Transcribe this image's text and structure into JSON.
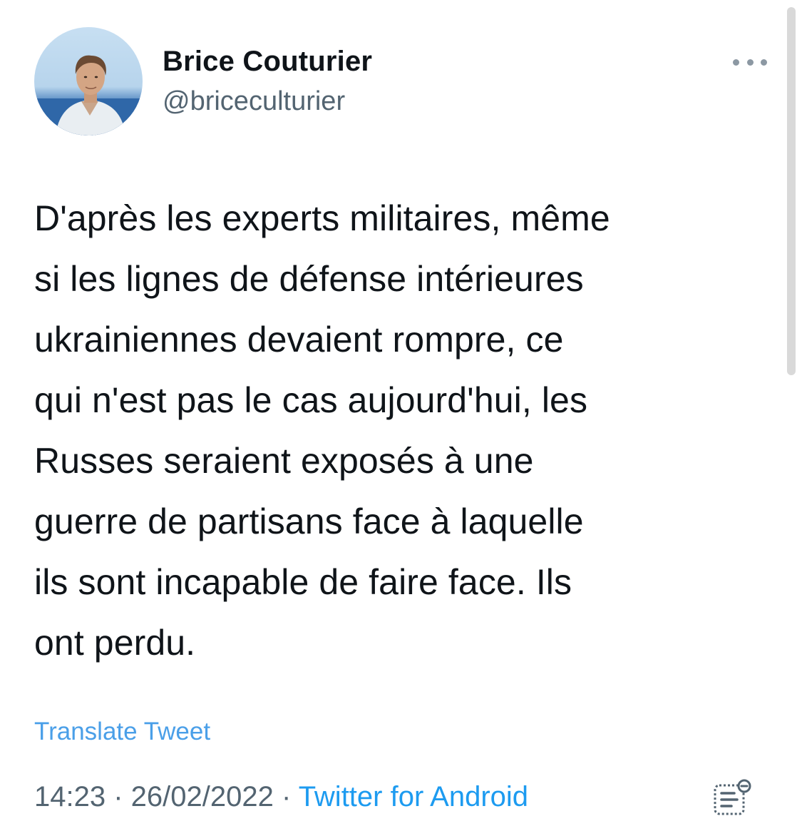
{
  "author": {
    "display_name": "Brice Couturier",
    "handle": "@briceculturier",
    "avatar_icon": "profile-photo"
  },
  "tweet": {
    "text": "D'après les experts militaires, même\nsi les lignes de défense intérieures\nukrainiennes devaient rompre, ce\nqui n'est pas le cas aujourd'hui, les\nRusses seraient exposés à une\nguerre de partisans face à laquelle\nils sont incapable de faire face. Ils\nont perdu.",
    "translate_label": "Translate Tweet"
  },
  "meta": {
    "time": "14:23",
    "separator": " · ",
    "date": "26/02/2022",
    "source": "Twitter for Android"
  },
  "icons": {
    "more": "more-horizontal-icon",
    "analytics": "tweet-analytics-icon"
  },
  "colors": {
    "text": "#0f1419",
    "secondary": "#536471",
    "link": "#1d9bf0",
    "translate": "#4a9fe8"
  }
}
